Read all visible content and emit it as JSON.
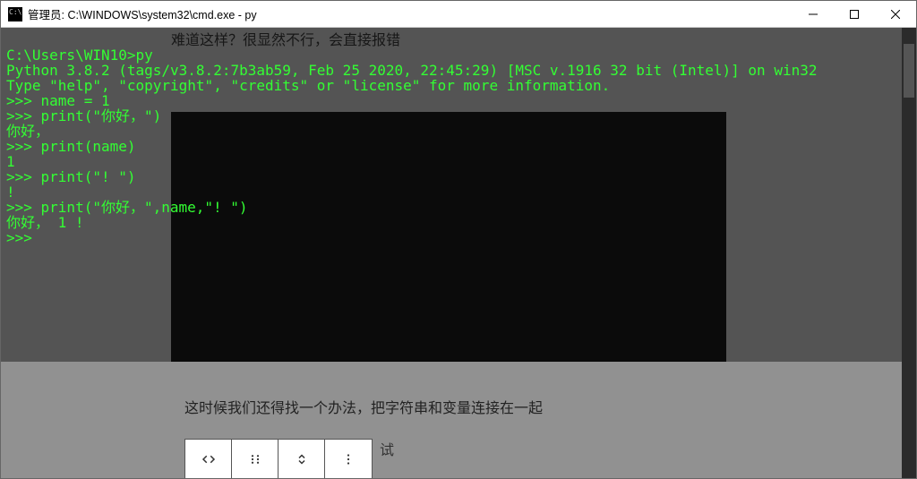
{
  "window": {
    "title": "管理员: C:\\WINDOWS\\system32\\cmd.exe - py"
  },
  "terminal": {
    "content": "C:\\Users\\WIN10>py\nPython 3.8.2 (tags/v3.8.2:7b3ab59, Feb 25 2020, 22:45:29) [MSC v.1916 32 bit (Intel)] on win32\nType \"help\", \"copyright\", \"credits\" or \"license\" for more information.\n>>> name = 1\n>>> print(\"你好，\")\n你好，\n>>> print(name)\n1\n>>> print(\"! \")\n!\n>>> print(\"你好，\",name,\"! \")\n你好， 1 !\n>>>"
  },
  "background_page": {
    "line1": "难道这样？很显然不行，会直接报错",
    "buttons": [
      "< >",
      ": :",
      "⌄"
    ],
    "line2": "这时候我们还得找一个办法，把字符串和变量连接在一起",
    "after_toolbar": "试"
  },
  "icons": {
    "app": "cmd-icon",
    "min": "minimize-icon",
    "max": "maximize-icon",
    "close": "close-icon",
    "tb_code": "code-brackets-icon",
    "tb_drag": "drag-handle-icon",
    "tb_updown": "updown-icon",
    "tb_more": "more-vertical-icon"
  }
}
